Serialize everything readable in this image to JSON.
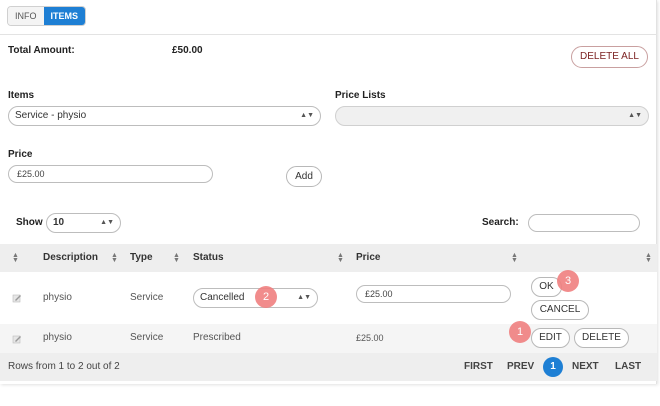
{
  "tabs": [
    {
      "label": "INFO",
      "active": false
    },
    {
      "label": "ITEMS",
      "active": true
    }
  ],
  "total": {
    "label": "Total Amount:",
    "value": "£50.00"
  },
  "delete_all_label": "DELETE ALL",
  "items_field": {
    "label": "Items",
    "value": "Service - physio"
  },
  "price_lists_field": {
    "label": "Price Lists",
    "value": ""
  },
  "price_field": {
    "label": "Price",
    "value": "£25.00"
  },
  "add_label": "Add",
  "show": {
    "label": "Show",
    "value": "10"
  },
  "search": {
    "label": "Search:",
    "value": ""
  },
  "table": {
    "headers": [
      "Description",
      "Type",
      "Status",
      "Price"
    ],
    "rows": [
      {
        "description": "physio",
        "type": "Service",
        "status": "Cancelled",
        "price": "£25.00",
        "editing": true,
        "actions": [
          "OK",
          "CANCEL"
        ]
      },
      {
        "description": "physio",
        "type": "Service",
        "status": "Prescribed",
        "price": "£25.00",
        "editing": false,
        "actions": [
          "EDIT",
          "DELETE"
        ]
      }
    ]
  },
  "footer": {
    "rows_info": "Rows from 1 to 2 out of 2",
    "first": "FIRST",
    "prev": "PREV",
    "current_page": "1",
    "next": "NEXT",
    "last": "LAST"
  },
  "annotations": {
    "badge_1": "1",
    "badge_2": "2",
    "badge_3": "3"
  },
  "colors": {
    "accent": "#1e7fd4",
    "badge": "#f08080",
    "delete_all_text": "#7a1f1f"
  }
}
